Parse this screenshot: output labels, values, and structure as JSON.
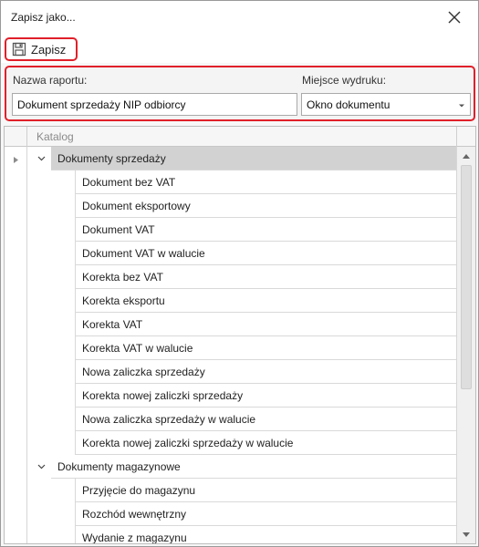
{
  "window": {
    "title": "Zapisz jako..."
  },
  "toolbar": {
    "save_label": "Zapisz"
  },
  "form": {
    "name_label": "Nazwa raportu:",
    "name_value": "Dokument sprzedaży NIP odbiorcy",
    "place_label": "Miejsce wydruku:",
    "place_value": "Okno dokumentu"
  },
  "grid": {
    "column_header": "Katalog",
    "groups": [
      {
        "label": "Dokumenty sprzedaży",
        "expanded": true,
        "selected": true,
        "children": [
          "Dokument bez VAT",
          "Dokument eksportowy",
          "Dokument VAT",
          "Dokument VAT w walucie",
          "Korekta bez VAT",
          "Korekta eksportu",
          "Korekta VAT",
          "Korekta VAT w walucie",
          "Nowa zaliczka sprzedaży",
          "Korekta nowej zaliczki sprzedaży",
          "Nowa zaliczka sprzedaży w walucie",
          "Korekta nowej zaliczki sprzedaży w walucie"
        ]
      },
      {
        "label": "Dokumenty magazynowe",
        "expanded": true,
        "selected": false,
        "children": [
          "Przyjęcie do magazynu",
          "Rozchód wewnętrzny",
          "Wydanie z magazynu"
        ]
      }
    ]
  },
  "colors": {
    "highlight_border": "#e0202a",
    "selected_row": "#d2d2d2"
  }
}
